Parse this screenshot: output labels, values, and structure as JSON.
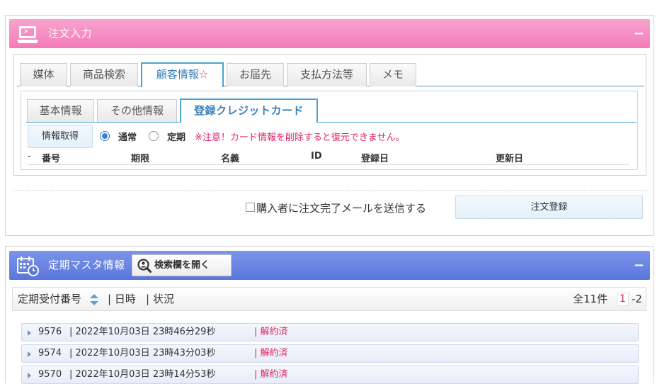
{
  "order_panel": {
    "title": "注文入力",
    "collapse": "−",
    "main_tabs": [
      {
        "label": "媒体"
      },
      {
        "label": "商品検索"
      },
      {
        "label": "顧客情報",
        "star": "☆"
      },
      {
        "label": "お届先"
      },
      {
        "label": "支払方法等"
      },
      {
        "label": "メモ"
      }
    ],
    "sub_tabs": [
      {
        "label": "基本情報"
      },
      {
        "label": "その他情報"
      },
      {
        "label": "登録クレジットカード"
      }
    ],
    "fetch_button": "情報取得",
    "radio_normal": "通常",
    "radio_subscription": "定期",
    "warning": "※注意！カード情報を削除すると復元できません。",
    "columns": {
      "dash": "-",
      "number": "番号",
      "expiry": "期限",
      "holder": "名義",
      "id": "ID",
      "registered": "登録日",
      "updated": "更新日"
    },
    "mail_checkbox_label": "購入者に注文完了メールを送信する",
    "submit_button": "注文登録"
  },
  "subscription_panel": {
    "title": "定期マスタ情報",
    "search_button": "検索欄を開く",
    "collapse": "−",
    "list_header": {
      "col1": "定期受付番号",
      "col2": "| 日時",
      "col3": "| 状況",
      "total": "全11件",
      "page_current": "1",
      "page_next": "-2"
    },
    "rows": [
      {
        "number": "9576",
        "datetime": "| 2022年10月03日 23時46分29秒",
        "status": "| 解約済"
      },
      {
        "number": "9574",
        "datetime": "| 2022年10月03日 23時43分03秒",
        "status": "| 解約済"
      },
      {
        "number": "9570",
        "datetime": "| 2022年10月03日 23時14分53秒",
        "status": "| 解約済"
      }
    ]
  },
  "colors": {
    "order_header": "#f27bb8",
    "subscription_header": "#5a76db",
    "tab_accent": "#4aa3d8",
    "warning_text": "#e0246d",
    "status_text": "#e0245e"
  },
  "icons": {
    "order_header": "laptop-icon",
    "subscription_header": "calendar-clock-icon",
    "search": "magnifier-person-icon",
    "sort": "sort-arrows-icon",
    "row_expand": "triangle-right-icon"
  }
}
